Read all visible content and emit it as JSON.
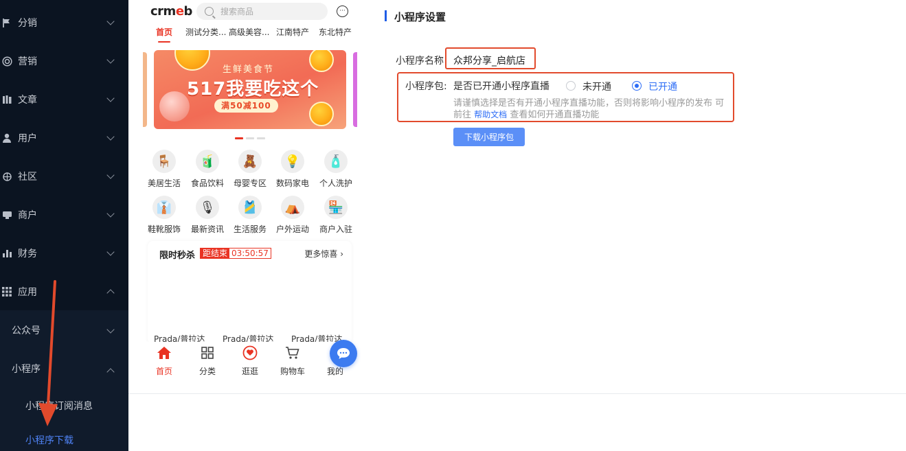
{
  "sidebar": {
    "items": [
      {
        "label": "分销",
        "icon": "flag-icon"
      },
      {
        "label": "营销",
        "icon": "target-icon"
      },
      {
        "label": "文章",
        "icon": "book-icon"
      },
      {
        "label": "用户",
        "icon": "user-icon"
      },
      {
        "label": "社区",
        "icon": "community-icon"
      },
      {
        "label": "商户",
        "icon": "store-icon"
      },
      {
        "label": "财务",
        "icon": "bar-chart-icon"
      },
      {
        "label": "应用",
        "icon": "apps-grid-icon"
      }
    ],
    "sub_items": [
      {
        "label": "公众号"
      },
      {
        "label": "小程序"
      }
    ],
    "leaves": [
      {
        "label": "小程序订阅消息"
      },
      {
        "label": "小程序下载"
      }
    ]
  },
  "phone": {
    "logo": "crmeb",
    "search_placeholder": "搜索商品",
    "tabs": [
      "首页",
      "测试分类...",
      "高级美容...",
      "江南特产",
      "东北特产"
    ],
    "banner": {
      "title": "生鲜美食节",
      "main": "517我要吃这个",
      "tag": "满50减100"
    },
    "grid": [
      {
        "label": "美居生活",
        "icon": "chair-icon",
        "glyph": "🪑"
      },
      {
        "label": "食品饮料",
        "icon": "snack-icon",
        "glyph": "🧃"
      },
      {
        "label": "母婴专区",
        "icon": "teddy-bear-icon",
        "glyph": "🧸"
      },
      {
        "label": "数码家电",
        "icon": "lamp-icon",
        "glyph": "💡"
      },
      {
        "label": "个人洗护",
        "icon": "lotion-icon",
        "glyph": "🧴"
      },
      {
        "label": "鞋靴服饰",
        "icon": "shirt-icon",
        "glyph": "👔"
      },
      {
        "label": "最新资讯",
        "icon": "microphone-icon",
        "glyph": "🎙"
      },
      {
        "label": "生活服务",
        "icon": "apron-icon",
        "glyph": "🎽"
      },
      {
        "label": "户外运动",
        "icon": "tent-icon",
        "glyph": "⛺"
      },
      {
        "label": "商户入驻",
        "icon": "storefront-icon",
        "glyph": "🏪"
      }
    ],
    "flash": {
      "title": "限时秒杀",
      "end_label": "距结束",
      "countdown": "03:50:57",
      "more": "更多惊喜",
      "products": [
        "Prada/普拉达",
        "Prada/普拉达",
        "Prada/普拉达"
      ]
    },
    "tabbar": [
      {
        "label": "首页",
        "icon": "home-icon"
      },
      {
        "label": "分类",
        "icon": "category-grid-icon"
      },
      {
        "label": "逛逛",
        "icon": "heart-chat-icon"
      },
      {
        "label": "购物车",
        "icon": "cart-icon"
      },
      {
        "label": "我的",
        "icon": "profile-icon"
      }
    ]
  },
  "settings": {
    "title": "小程序设置",
    "name_label": "小程序名称",
    "name_value": "众邦分享_启航店",
    "pkg_label": "小程序包:",
    "live_question": "是否已开通小程序直播",
    "option_off": "未开通",
    "option_on": "已开通",
    "selected": "已开通",
    "hint_text": "请谨慎选择是否有开通小程序直播功能，否则将影响小程序的发布 可前往",
    "hint_link": "帮助文档",
    "hint_tail": "查看如何开通直播功能",
    "download_button": "下载小程序包"
  },
  "colors": {
    "sidebar_bg": "#0b1421",
    "accent": "#2d6df6",
    "brand_red": "#e93323",
    "annotation_red": "#e24a2c"
  }
}
